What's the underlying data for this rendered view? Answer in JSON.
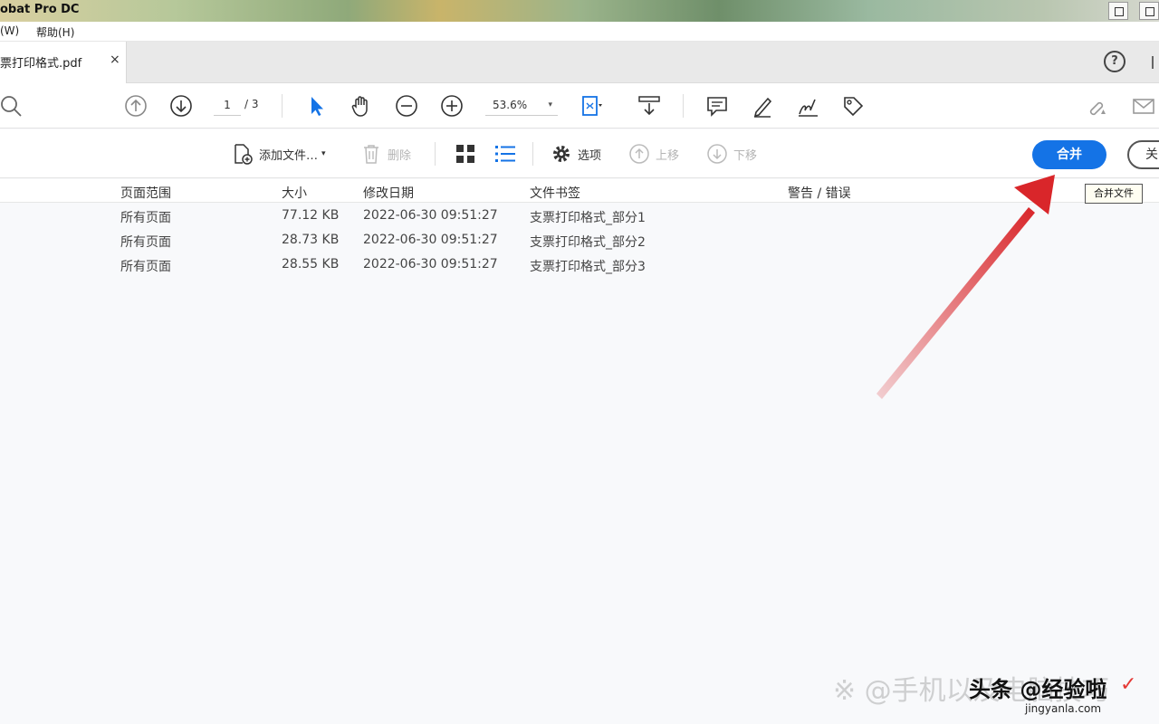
{
  "window": {
    "title": "obat Pro DC"
  },
  "menu": {
    "items": [
      "(W)",
      "帮助(H)"
    ]
  },
  "tab": {
    "label": "票打印格式.pdf",
    "close": "×"
  },
  "help": {
    "label": "?"
  },
  "toolbar": {
    "page_current": "1",
    "page_total": "/ 3",
    "zoom": "53.6%",
    "zoom_caret": "▾",
    "icons": [
      "search-icon",
      "page-up-icon",
      "page-down-icon",
      "select-cursor-icon",
      "hand-icon",
      "zoom-out-icon",
      "zoom-in-icon",
      "fit-page-icon",
      "scroll-mode-icon",
      "comment-icon",
      "highlight-pen-icon",
      "sign-icon",
      "stamp-icon",
      "share-link-icon",
      "mail-icon"
    ]
  },
  "commands": {
    "add_files": "添加文件…",
    "add_files_caret": "▾",
    "delete": "删除",
    "options": "选项",
    "move_up": "上移",
    "move_down": "下移",
    "combine": "合并",
    "close": "关",
    "tooltip": "合并文件"
  },
  "table": {
    "columns": [
      "页面范围",
      "大小",
      "修改日期",
      "文件书签",
      "警告 / 错误"
    ],
    "rows": [
      [
        "所有页面",
        "77.12 KB",
        "2022-06-30 09:51:27",
        "支票打印格式_部分1"
      ],
      [
        "所有页面",
        "28.73 KB",
        "2022-06-30 09:51:27",
        "支票打印格式_部分2"
      ],
      [
        "所有页面",
        "28.55 KB",
        "2022-06-30 09:51:27",
        "支票打印格式_部分3"
      ]
    ]
  },
  "watermark": {
    "text": "※ @手机以及电脑技巧",
    "brand": "头条 @经验啦",
    "site": "jingyanla.com",
    "check": "✓"
  },
  "colors": {
    "accent": "#1473e6",
    "arrow": "#d9262a",
    "selected_tool": "#1473e6"
  }
}
